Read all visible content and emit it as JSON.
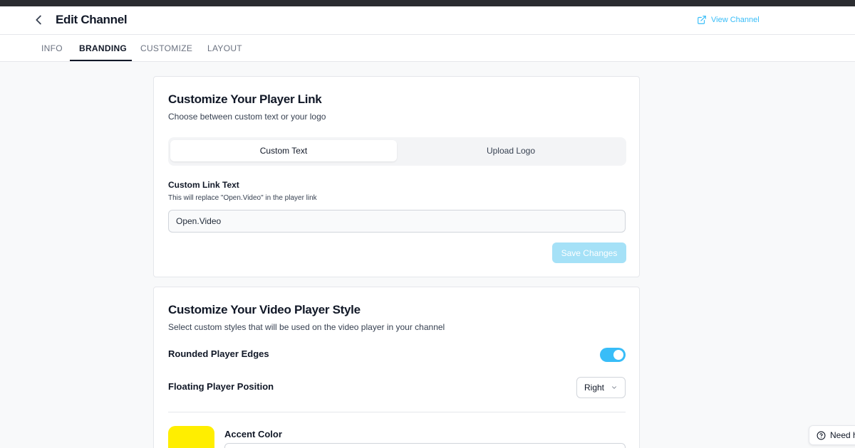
{
  "header": {
    "title": "Edit Channel",
    "back_icon": "chevron-left-icon",
    "view_channel_label": "View Channel",
    "view_channel_icon": "external-link-icon"
  },
  "tabs": [
    {
      "label": "INFO",
      "active": false
    },
    {
      "label": "BRANDING",
      "active": true
    },
    {
      "label": "CUSTOMIZE",
      "active": false
    },
    {
      "label": "LAYOUT",
      "active": false
    }
  ],
  "player_link": {
    "title": "Customize Your Player Link",
    "subtitle": "Choose between custom text or your logo",
    "options": [
      {
        "label": "Custom Text",
        "selected": true
      },
      {
        "label": "Upload Logo",
        "selected": false
      }
    ],
    "field_label": "Custom Link Text",
    "field_help": "This will replace \"Open.Video\" in the player link",
    "field_value": "Open.Video",
    "save_label": "Save Changes"
  },
  "player_style": {
    "title": "Customize Your Video Player Style",
    "subtitle": "Select custom styles that will be used on the video player in your channel",
    "rounded_label": "Rounded Player Edges",
    "rounded_enabled": true,
    "floating_label": "Floating Player Position",
    "floating_value": "Right",
    "accent_label": "Accent Color",
    "accent_color": "#ffee00"
  },
  "help": {
    "label": "Need h",
    "icon": "help-circle-icon"
  },
  "colors": {
    "accent": "#38bdf8",
    "save_disabled": "#a5e1f7",
    "swatch": "#ffee00"
  }
}
